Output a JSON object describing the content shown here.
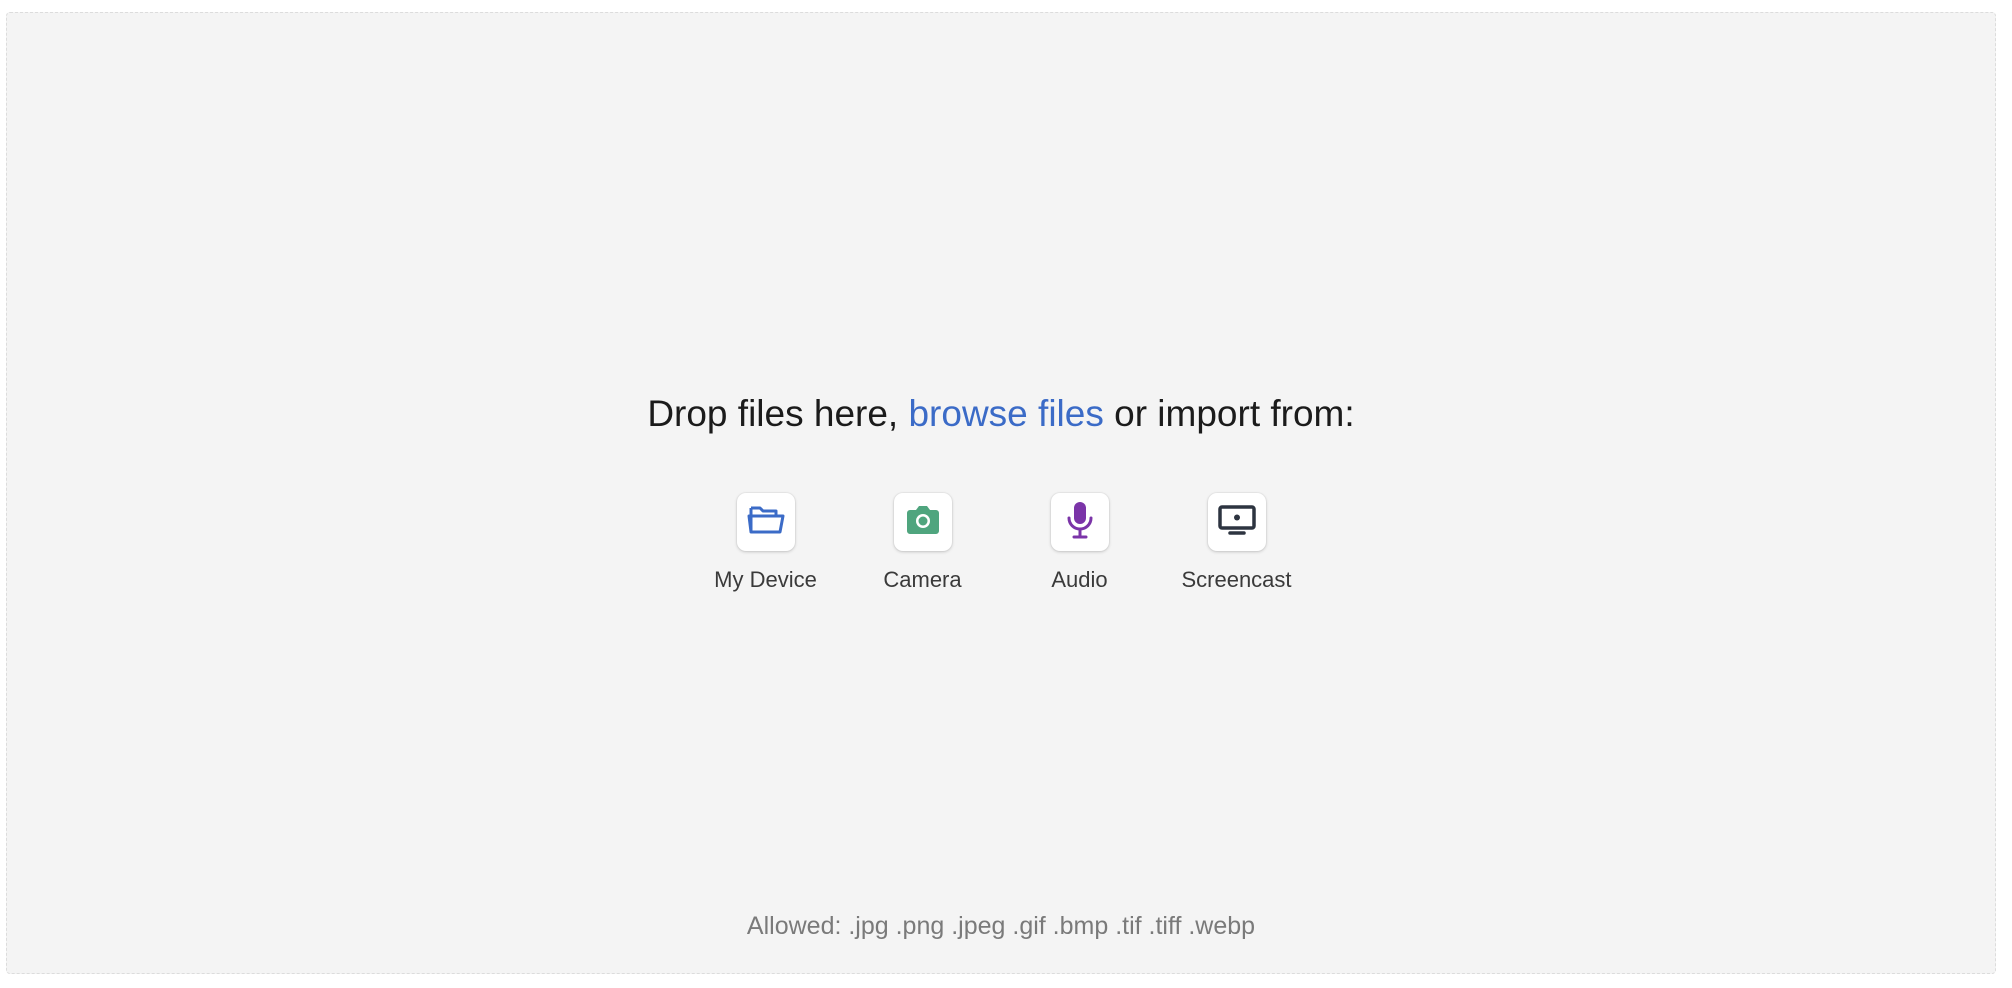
{
  "dropzone": {
    "headline_prefix": "Drop files here, ",
    "browse_link": "browse files",
    "headline_suffix": " or import from:",
    "allowed_text": "Allowed: .jpg .png .jpeg .gif .bmp .tif .tiff .webp"
  },
  "sources": [
    {
      "label": "My Device",
      "icon": "folder-icon",
      "color": "#3b6bc7"
    },
    {
      "label": "Camera",
      "icon": "camera-icon",
      "color": "#4fa57e"
    },
    {
      "label": "Audio",
      "icon": "microphone-icon",
      "color": "#7b34a8"
    },
    {
      "label": "Screencast",
      "icon": "monitor-icon",
      "color": "#2d3440"
    }
  ],
  "colors": {
    "background": "#f4f4f4",
    "link": "#3b6bc7"
  }
}
